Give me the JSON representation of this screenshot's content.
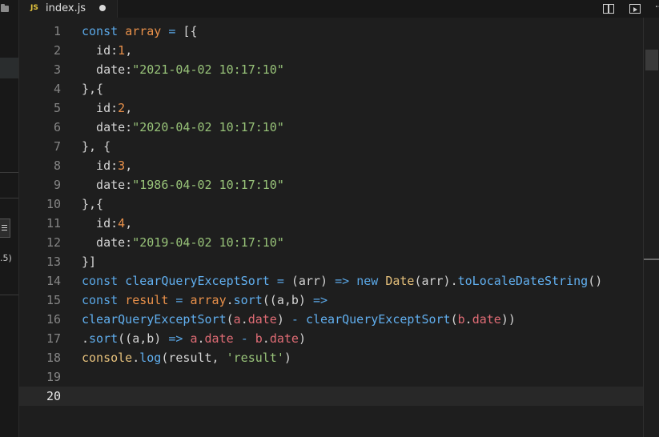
{
  "sidebar": {
    "partial_text": ".5)"
  },
  "tab": {
    "icon_label": "JS",
    "file_name": "index.js"
  },
  "toolbar": {
    "more_label": "···"
  },
  "editor": {
    "lines": [
      {
        "n": "1",
        "tokens": [
          [
            "kw",
            "const "
          ],
          [
            "var",
            "array"
          ],
          [
            "punc",
            " "
          ],
          [
            "op",
            "="
          ],
          [
            "punc",
            " [{"
          ]
        ]
      },
      {
        "n": "2",
        "tokens": [
          [
            "punc",
            "  id:"
          ],
          [
            "num",
            "1"
          ],
          [
            "punc",
            ","
          ]
        ]
      },
      {
        "n": "3",
        "tokens": [
          [
            "punc",
            "  date:"
          ],
          [
            "str",
            "\"2021-04-02 10:17:10\""
          ]
        ]
      },
      {
        "n": "4",
        "tokens": [
          [
            "punc",
            "},{"
          ]
        ]
      },
      {
        "n": "5",
        "tokens": [
          [
            "punc",
            "  id:"
          ],
          [
            "num",
            "2"
          ],
          [
            "punc",
            ","
          ]
        ]
      },
      {
        "n": "6",
        "tokens": [
          [
            "punc",
            "  date:"
          ],
          [
            "str",
            "\"2020-04-02 10:17:10\""
          ]
        ]
      },
      {
        "n": "7",
        "tokens": [
          [
            "punc",
            "}, {"
          ]
        ]
      },
      {
        "n": "8",
        "tokens": [
          [
            "punc",
            "  id:"
          ],
          [
            "num",
            "3"
          ],
          [
            "punc",
            ","
          ]
        ]
      },
      {
        "n": "9",
        "tokens": [
          [
            "punc",
            "  date:"
          ],
          [
            "str",
            "\"1986-04-02 10:17:10\""
          ]
        ]
      },
      {
        "n": "10",
        "tokens": [
          [
            "punc",
            "},{"
          ]
        ]
      },
      {
        "n": "11",
        "tokens": [
          [
            "punc",
            "  id:"
          ],
          [
            "num",
            "4"
          ],
          [
            "punc",
            ","
          ]
        ]
      },
      {
        "n": "12",
        "tokens": [
          [
            "punc",
            "  date:"
          ],
          [
            "str",
            "\"2019-04-02 10:17:10\""
          ]
        ]
      },
      {
        "n": "13",
        "tokens": [
          [
            "punc",
            "}]"
          ]
        ]
      },
      {
        "n": "14",
        "tokens": [
          [
            "kw",
            "const "
          ],
          [
            "fn",
            "clearQueryExceptSort"
          ],
          [
            "punc",
            " "
          ],
          [
            "op",
            "="
          ],
          [
            "punc",
            " (arr) "
          ],
          [
            "op",
            "=>"
          ],
          [
            "punc",
            " "
          ],
          [
            "kw",
            "new "
          ],
          [
            "cls",
            "Date"
          ],
          [
            "punc",
            "(arr)."
          ],
          [
            "fn",
            "toLocaleDateString"
          ],
          [
            "punc",
            "()"
          ]
        ]
      },
      {
        "n": "15",
        "tokens": [
          [
            "kw",
            "const "
          ],
          [
            "var",
            "result"
          ],
          [
            "punc",
            " "
          ],
          [
            "op",
            "="
          ],
          [
            "punc",
            " "
          ],
          [
            "var",
            "array"
          ],
          [
            "punc",
            "."
          ],
          [
            "fn",
            "sort"
          ],
          [
            "punc",
            "((a,b) "
          ],
          [
            "op",
            "=>"
          ]
        ]
      },
      {
        "n": "16",
        "tokens": [
          [
            "fn",
            "clearQueryExceptSort"
          ],
          [
            "punc",
            "("
          ],
          [
            "err",
            "a"
          ],
          [
            "punc",
            "."
          ],
          [
            "err",
            "date"
          ],
          [
            "punc",
            ") "
          ],
          [
            "op",
            "-"
          ],
          [
            "punc",
            " "
          ],
          [
            "fn",
            "clearQueryExceptSort"
          ],
          [
            "punc",
            "("
          ],
          [
            "err",
            "b"
          ],
          [
            "punc",
            "."
          ],
          [
            "err",
            "date"
          ],
          [
            "punc",
            "))"
          ]
        ]
      },
      {
        "n": "17",
        "tokens": [
          [
            "punc",
            "."
          ],
          [
            "fn",
            "sort"
          ],
          [
            "punc",
            "((a,b) "
          ],
          [
            "op",
            "=>"
          ],
          [
            "punc",
            " "
          ],
          [
            "err",
            "a"
          ],
          [
            "punc",
            "."
          ],
          [
            "err",
            "date"
          ],
          [
            "punc",
            " "
          ],
          [
            "op",
            "-"
          ],
          [
            "punc",
            " "
          ],
          [
            "err",
            "b"
          ],
          [
            "punc",
            "."
          ],
          [
            "err",
            "date"
          ],
          [
            "punc",
            ")"
          ]
        ]
      },
      {
        "n": "18",
        "tokens": [
          [
            "obj",
            "console"
          ],
          [
            "punc",
            "."
          ],
          [
            "fn",
            "log"
          ],
          [
            "punc",
            "(result, "
          ],
          [
            "str",
            "'result'"
          ],
          [
            "punc",
            ")"
          ]
        ]
      },
      {
        "n": "19",
        "tokens": []
      },
      {
        "n": "20",
        "tokens": []
      }
    ],
    "active_line": "20"
  },
  "colors": {
    "background": "#1e1e1e",
    "keyword": "#5aa7e6",
    "variable": "#e8904a",
    "string": "#98c379",
    "function": "#61afef",
    "class": "#e5c07b",
    "property_error": "#e06c75"
  },
  "icons": [
    "folder-icon",
    "menu-icon",
    "js-file-icon",
    "unsaved-dot-icon",
    "split-editor-icon",
    "open-preview-icon",
    "more-actions-icon"
  ]
}
